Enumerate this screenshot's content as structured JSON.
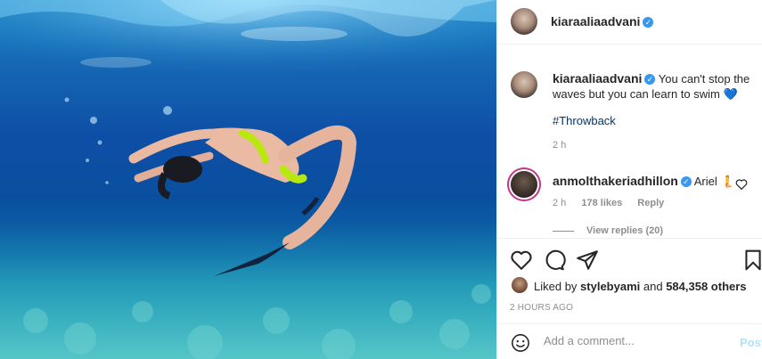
{
  "post": {
    "image_alt": "",
    "author": {
      "username": "kiaraaliaadvani",
      "verified": true
    },
    "caption": {
      "username": "kiaraaliaadvani",
      "text": "You can't stop the waves but you can learn to swim",
      "emoji": "💙",
      "hashtag": "#Throwback",
      "time": "2 h"
    },
    "comments": [
      {
        "username": "anmolthakeriadhillon",
        "verified": true,
        "text": "Ariel",
        "emoji": "🧜",
        "time": "2 h",
        "likes": "178 likes",
        "reply_label": "Reply",
        "view_replies": "View replies (20)"
      }
    ],
    "liked_by": {
      "prefix": "Liked by",
      "user": "stylebyami",
      "and": "and",
      "count": "584,358 others"
    },
    "posted_time": "2 HOURS AGO",
    "add_comment": {
      "placeholder": "Add a comment...",
      "post_label": "Post"
    }
  },
  "icons": {
    "verified": "verified-badge-icon",
    "like": "heart-icon",
    "comment": "comment-icon",
    "share": "paper-plane-icon",
    "save": "bookmark-icon",
    "emoji": "smiley-icon",
    "comment_like": "heart-outline-icon"
  },
  "colors": {
    "accent": "#3897f0",
    "link": "#00376b",
    "muted": "#8e8e8e",
    "post_disabled": "#b2dffc"
  }
}
